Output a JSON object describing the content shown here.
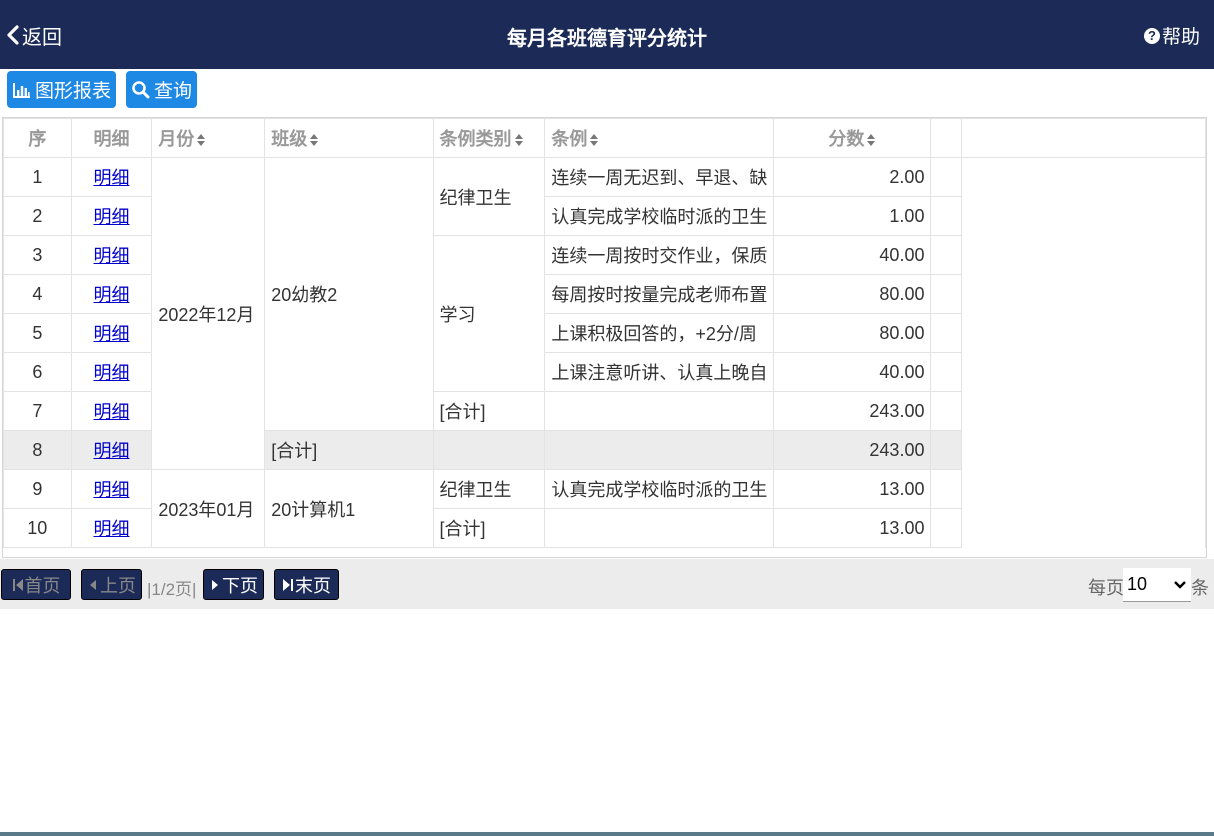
{
  "header": {
    "back_label": "返回",
    "title": "每月各班德育评分统计",
    "help_label": "帮助"
  },
  "toolbar": {
    "chart_report_label": "图形报表",
    "query_label": "查询"
  },
  "table": {
    "columns": [
      "序",
      "明细",
      "月份",
      "班级",
      "条例类别",
      "条例",
      "分数"
    ],
    "detail_link": "明细",
    "rows": [
      {
        "seq": "1",
        "month": "2022年12月",
        "class": "20幼教2",
        "category": "纪律卫生",
        "rule": "连续一周无迟到、早退、缺",
        "score": "2.00"
      },
      {
        "seq": "2",
        "month": "",
        "class": "",
        "category": "",
        "rule": "认真完成学校临时派的卫生",
        "score": "1.00"
      },
      {
        "seq": "3",
        "month": "",
        "class": "",
        "category": "学习",
        "rule": "连续一周按时交作业，保质",
        "score": "40.00"
      },
      {
        "seq": "4",
        "month": "",
        "class": "",
        "category": "",
        "rule": "每周按时按量完成老师布置",
        "score": "80.00"
      },
      {
        "seq": "5",
        "month": "",
        "class": "",
        "category": "",
        "rule": "上课积极回答的，+2分/周",
        "score": "80.00"
      },
      {
        "seq": "6",
        "month": "",
        "class": "",
        "category": "",
        "rule": "上课注意听讲、认真上晚自",
        "score": "40.00"
      },
      {
        "seq": "7",
        "month": "",
        "class": "",
        "category": "[合计]",
        "rule": "",
        "score": "243.00"
      },
      {
        "seq": "8",
        "month": "",
        "class": "[合计]",
        "category": "",
        "rule": "",
        "score": "243.00"
      },
      {
        "seq": "9",
        "month": "2023年01月",
        "class": "20计算机1",
        "category": "纪律卫生",
        "rule": "认真完成学校临时派的卫生",
        "score": "13.00"
      },
      {
        "seq": "10",
        "month": "",
        "class": "",
        "category": "[合计]",
        "rule": "",
        "score": "13.00"
      }
    ]
  },
  "pager": {
    "first_label": "首页",
    "prev_label": "上页",
    "page_info": "|1/2页|",
    "next_label": "下页",
    "last_label": "末页",
    "per_page_label": "每页",
    "per_page_value": "10",
    "per_page_unit": "条"
  },
  "colors": {
    "header_bg": "#1b2a57",
    "button_blue": "#1e88e5",
    "link": "#0000cc",
    "subtotal_bg": "#ececec"
  }
}
